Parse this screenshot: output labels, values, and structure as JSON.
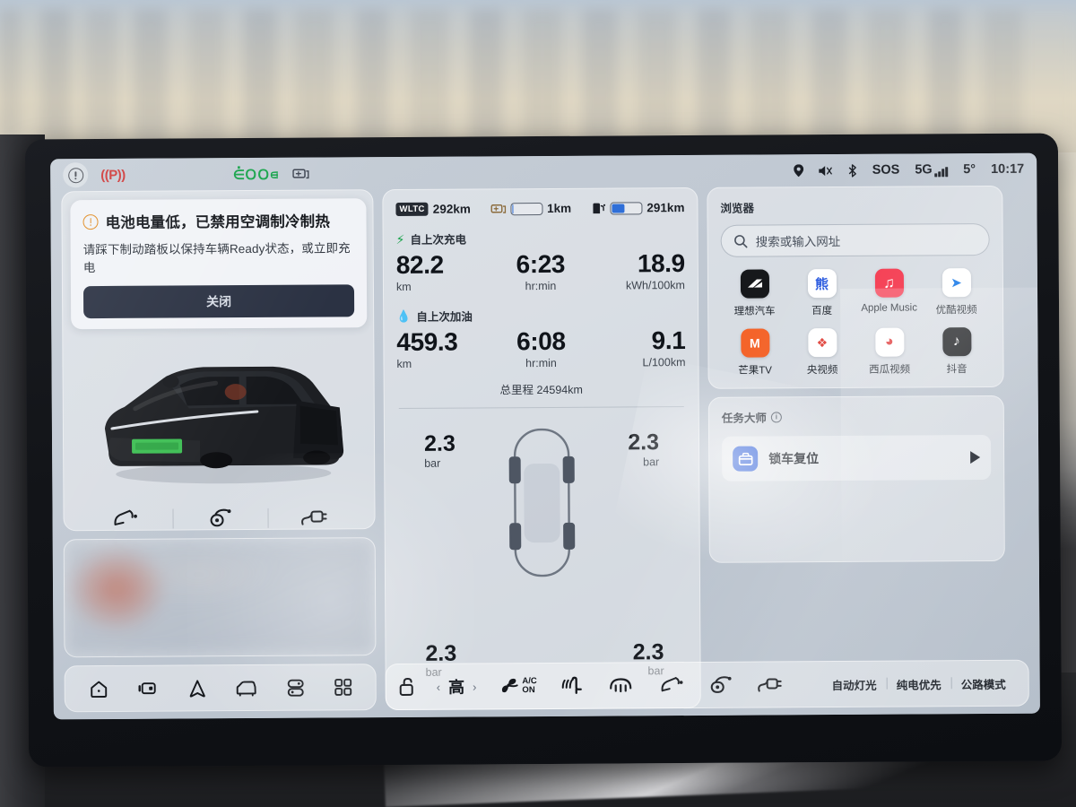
{
  "status_bar": {
    "left_icons": [
      {
        "name": "warning-indicator",
        "label": "!"
      },
      {
        "name": "parking-brake-indicator",
        "label": "(P)"
      }
    ],
    "mid_icons": [
      {
        "name": "headlight-indicator",
        "label": "lights"
      },
      {
        "name": "battery-indicator",
        "label": "battery"
      }
    ],
    "right": {
      "location": "location-pin",
      "mute": "mute-icon",
      "bluetooth": "bluetooth-icon",
      "sos": "SOS",
      "network": "5G",
      "temperature": "5°",
      "time": "10:17"
    }
  },
  "alert": {
    "title": "电池电量低，已禁用空调制冷制热",
    "subtitle": "请踩下制动踏板以保持车辆Ready状态，或立即充电",
    "button": "关闭"
  },
  "vehicle": {
    "flap_buttons": [
      {
        "name": "fuel-flap-button",
        "label": "fuel-flap-icon"
      },
      {
        "name": "charge-port-button",
        "label": "charge-port-icon"
      },
      {
        "name": "charge-cable-button",
        "label": "charge-cable-icon"
      }
    ]
  },
  "bottom_nav": [
    {
      "name": "nav-home",
      "icon": "home-icon"
    },
    {
      "name": "nav-dashcam",
      "icon": "dashcam-icon"
    },
    {
      "name": "nav-navigation",
      "icon": "navigation-arrow-icon"
    },
    {
      "name": "nav-vehicle",
      "icon": "car-icon"
    },
    {
      "name": "nav-media",
      "icon": "media-icon"
    },
    {
      "name": "nav-apps",
      "icon": "apps-grid-icon"
    }
  ],
  "center": {
    "range": [
      {
        "name": "wltc-range",
        "badge": "WLTC",
        "value": "292km"
      },
      {
        "name": "battery-range",
        "icon": "battery-icon",
        "value": "1km",
        "fill_percent": 3,
        "fill_color": "#2f6fd8"
      },
      {
        "name": "fuel-range",
        "icon": "fuel-pump-icon",
        "value": "291km",
        "fill_percent": 42,
        "fill_color": "#2f6fd8"
      }
    ],
    "since_charge": {
      "label": "自上次充电",
      "distance": "82.2",
      "distance_unit": "km",
      "time": "6:23",
      "time_unit": "hr:min",
      "consumption": "18.9",
      "consumption_unit": "kWh/100km"
    },
    "since_refuel": {
      "label": "自上次加油",
      "distance": "459.3",
      "distance_unit": "km",
      "time": "6:08",
      "time_unit": "hr:min",
      "consumption": "9.1",
      "consumption_unit": "L/100km"
    },
    "odometer": "总里程  24594km",
    "tire_pressure": {
      "front_left": {
        "value": "2.3",
        "unit": "bar"
      },
      "front_right": {
        "value": "2.3",
        "unit": "bar"
      },
      "rear_left": {
        "value": "2.3",
        "unit": "bar"
      },
      "rear_right": {
        "value": "2.3",
        "unit": "bar"
      }
    }
  },
  "climate": {
    "lock_icon": "unlock-icon",
    "temp_prev": "‹",
    "temp_value": "高",
    "temp_next": "›",
    "fan_icon": "fan-icon",
    "ac_line1": "A/C",
    "ac_line2": "ON",
    "seat_heat_icon": "heated-seat-icon",
    "defrost_icon": "rear-defrost-icon",
    "flap_icons": [
      "fuel-flap-icon",
      "charge-port-icon",
      "charge-cable-icon"
    ],
    "modes": [
      {
        "name": "auto-lights-chip",
        "label": "自动灯光"
      },
      {
        "name": "ev-priority-chip",
        "label": "纯电优先"
      },
      {
        "name": "road-mode-chip",
        "label": "公路模式"
      }
    ]
  },
  "browser": {
    "title": "浏览器",
    "search_placeholder": "搜索或输入网址",
    "apps": [
      {
        "label": "理想汽车",
        "bg": "#16181b",
        "glyph": "◣"
      },
      {
        "label": "百度",
        "bg": "#ffffff",
        "glyph": "熊",
        "fg": "#2a5adf"
      },
      {
        "label": "Apple Music",
        "bg": "#f4364c",
        "glyph": "♫"
      },
      {
        "label": "优酷视频",
        "bg": "#ffffff",
        "glyph": "▶",
        "fg": "#1a7ae8"
      },
      {
        "label": "芒果TV",
        "bg": "#f4642a",
        "glyph": "M"
      },
      {
        "label": "央视频",
        "bg": "#ffffff",
        "glyph": "❖",
        "fg": "#e0443c"
      },
      {
        "label": "西瓜视频",
        "bg": "#ffffff",
        "glyph": "●",
        "fg": "#e03a3a"
      },
      {
        "label": "抖音",
        "bg": "#16181b",
        "glyph": "♪"
      }
    ]
  },
  "task_master": {
    "title": "任务大师",
    "info": "i",
    "task_label": "锁车复位",
    "task_icon": "lock-reset-icon",
    "play": "play-icon"
  }
}
